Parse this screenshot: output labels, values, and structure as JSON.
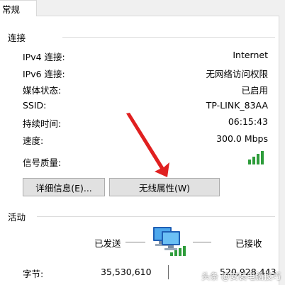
{
  "tabs": {
    "general": "常规"
  },
  "connection": {
    "title": "连接",
    "rows": [
      {
        "label": "IPv4 连接:",
        "value": "Internet"
      },
      {
        "label": "IPv6 连接:",
        "value": "无网络访问权限"
      },
      {
        "label": "媒体状态:",
        "value": "已启用"
      },
      {
        "label": "SSID:",
        "value": "TP-LINK_83AA"
      },
      {
        "label": "持续时间:",
        "value": "06:15:43"
      },
      {
        "label": "速度:",
        "value": "300.0 Mbps"
      }
    ],
    "signal_label": "信号质量:",
    "signal_bars": 4
  },
  "buttons": {
    "details": "详细信息(E)...",
    "wireless": "无线属性(W)"
  },
  "activity": {
    "title": "活动",
    "sent_label": "已发送",
    "received_label": "已接收",
    "bytes_label": "字节:",
    "bytes_sent": "35,530,610",
    "bytes_received": "520,928,443"
  },
  "watermark": "头条 @安装电脑技巧",
  "colors": {
    "signal": "#2d9c3a",
    "arrow": "#e02020",
    "button_bg": "#e1e1e1"
  }
}
